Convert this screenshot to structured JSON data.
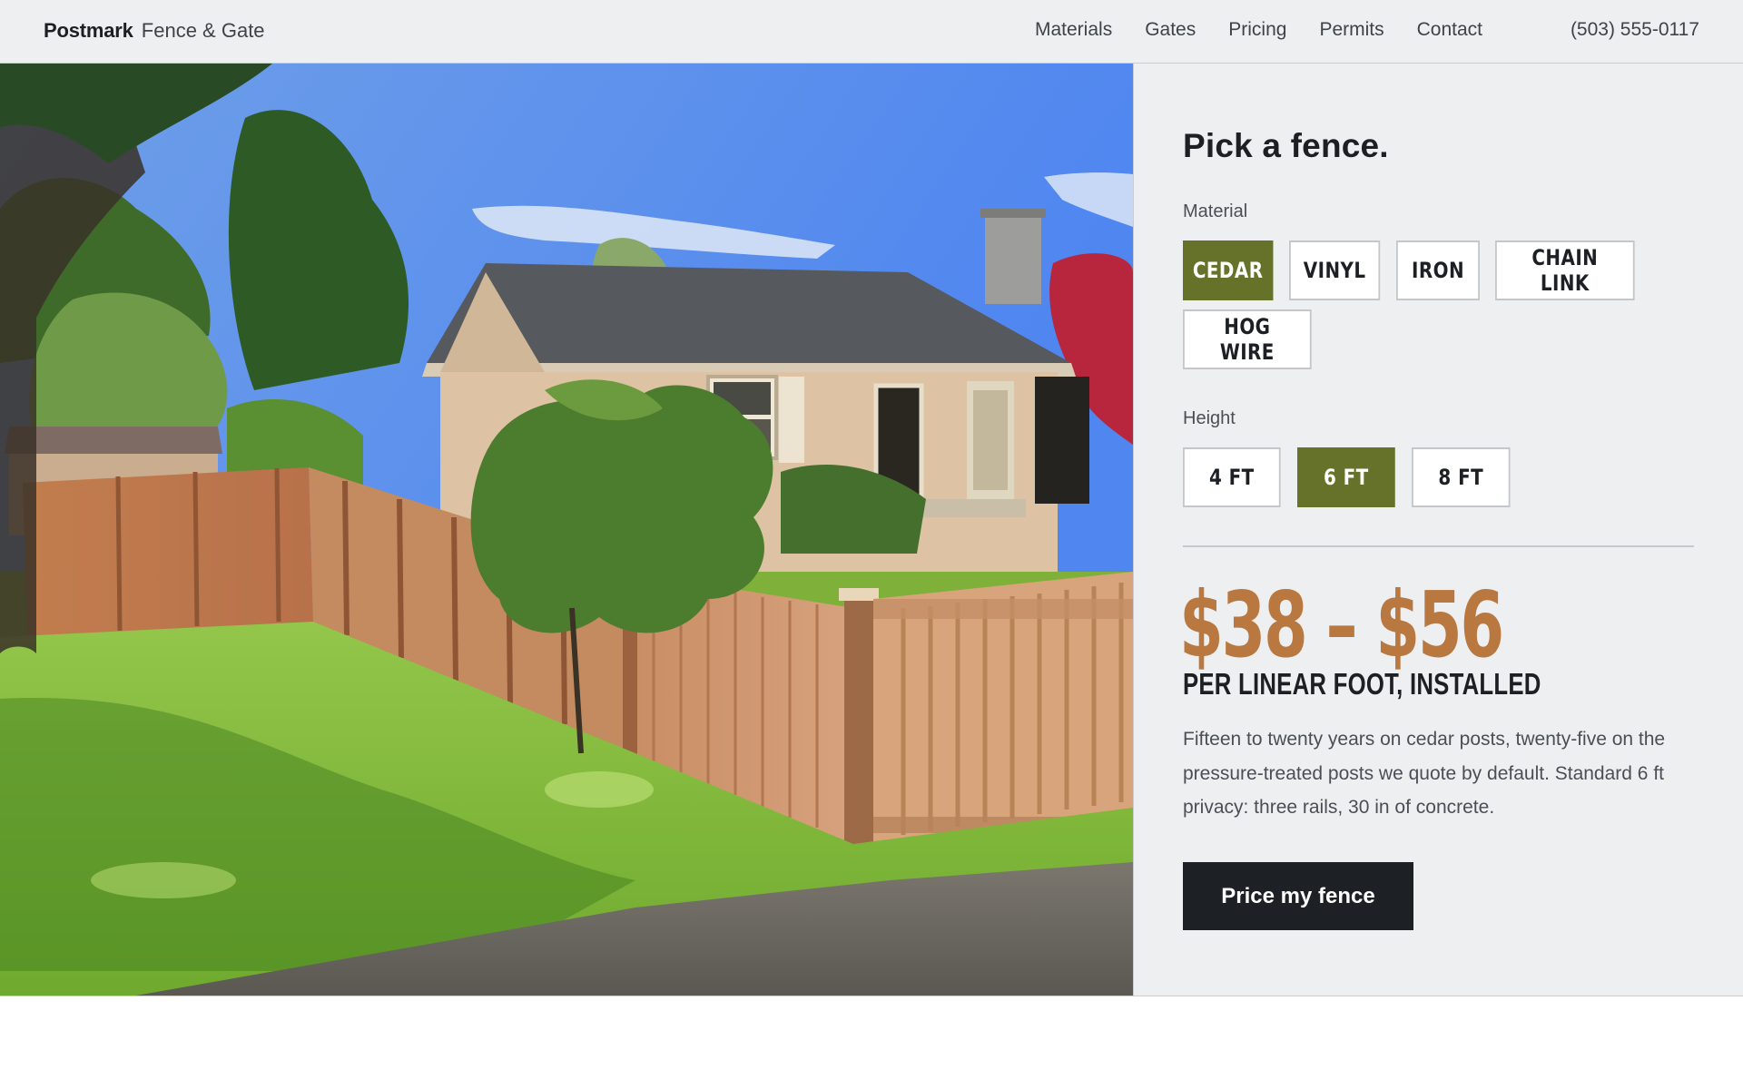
{
  "header": {
    "brand_name": "Postmark",
    "brand_sub": "Fence & Gate",
    "nav": [
      "Materials",
      "Gates",
      "Pricing",
      "Permits",
      "Contact"
    ],
    "phone": "(503) 555-0117"
  },
  "panel": {
    "heading": "Pick a fence.",
    "material_label": "Material",
    "materials": [
      "CEDAR",
      "VINYL",
      "IRON",
      "CHAIN LINK",
      "HOG WIRE"
    ],
    "material_selected": "CEDAR",
    "height_label": "Height",
    "heights": [
      "4 FT",
      "6 FT",
      "8 FT"
    ],
    "height_selected": "6 FT",
    "price": "$38 – $56",
    "price_unit": "PER LINEAR FOOT, INSTALLED",
    "description": "Fifteen to twenty years on cedar posts, twenty-five on the pressure-treated posts we quote by default. Standard 6 ft privacy: three rails, 30 in of concrete.",
    "cta": "Price my fence"
  },
  "colors": {
    "accent": "#667229",
    "price": "#b97840",
    "dark": "#1d2024",
    "panel_bg": "#eeeff1"
  },
  "hero": {
    "image": "house-with-cedar-fence-photo"
  }
}
